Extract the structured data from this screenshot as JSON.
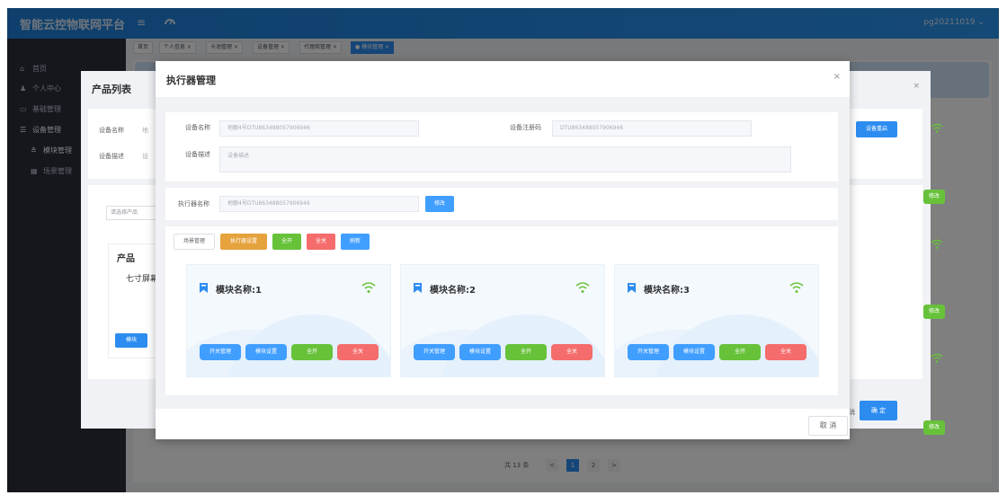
{
  "header": {
    "brand": "智能云控物联网平台",
    "menu_icon": "menu-icon",
    "dashboard_icon": "dashboard-icon",
    "user": "pg20211019 ⌄"
  },
  "sidebar": {
    "items": [
      {
        "label": "首页",
        "icon": "home-icon"
      },
      {
        "label": "个人中心",
        "icon": "user-icon"
      },
      {
        "label": "基础管理",
        "icon": "monitor-icon"
      },
      {
        "label": "设备管理",
        "icon": "list-icon"
      },
      {
        "label": "模块管理",
        "icon": "layers-icon"
      },
      {
        "label": "场景管理",
        "icon": "grid-icon"
      }
    ]
  },
  "tags": [
    {
      "label": "首页"
    },
    {
      "label": "个人信息 ×"
    },
    {
      "label": "卡池管理 ×"
    },
    {
      "label": "设备管理 ×"
    },
    {
      "label": "代理商管理 ×"
    },
    {
      "label": "● 模块管理 ×"
    }
  ],
  "pagination": {
    "total": "共 13 条",
    "prev": "<",
    "pages": [
      "1",
      "2"
    ],
    "next": ">"
  },
  "product_dialog": {
    "title": "产品列表",
    "close": "×",
    "device_name_label": "设备名称",
    "device_name_value": "地",
    "device_desc_label": "设备描述",
    "device_desc_value": "设",
    "reset_button": "设备重启",
    "select_placeholder": "请选择产品",
    "card_title": "产品",
    "card_sub": "七寸屏幕",
    "card_button": "模块",
    "edit_label": "修改",
    "cancel": "消",
    "ok": "确 定"
  },
  "executor_dialog": {
    "title": "执行器管理",
    "close": "×",
    "device_name_label": "设备名称",
    "device_name_value": "地额4号DTU863488057906946",
    "reg_code_label": "设备注册码",
    "reg_code_value": "DTU863488057906946",
    "device_desc_label": "设备描述",
    "device_desc_placeholder": "设备描述",
    "executor_name_label": "执行器名称",
    "executor_name_value": "地额4号DTU863488057906946",
    "modify_button": "修改",
    "toolbar": {
      "scene": "场景管理",
      "exec_settings": "执行器设置",
      "all_on": "全开",
      "all_off": "全关",
      "refresh": "刷新"
    },
    "modules": [
      {
        "title": "模块名称:1",
        "btn_switch": "开关管理",
        "btn_settings": "模块设置",
        "btn_on": "全开",
        "btn_off": "全关"
      },
      {
        "title": "模块名称:2",
        "btn_switch": "开关管理",
        "btn_settings": "模块设置",
        "btn_on": "全开",
        "btn_off": "全关"
      },
      {
        "title": "模块名称:3",
        "btn_switch": "开关管理",
        "btn_settings": "模块设置",
        "btn_on": "全开",
        "btn_off": "全关"
      }
    ],
    "cancel": "取 消"
  },
  "colors": {
    "primary": "#2d8cf0",
    "success": "#67c23a",
    "warning": "#e6a23c",
    "danger": "#f56c6c",
    "sidebar": "#2b2f3a"
  }
}
